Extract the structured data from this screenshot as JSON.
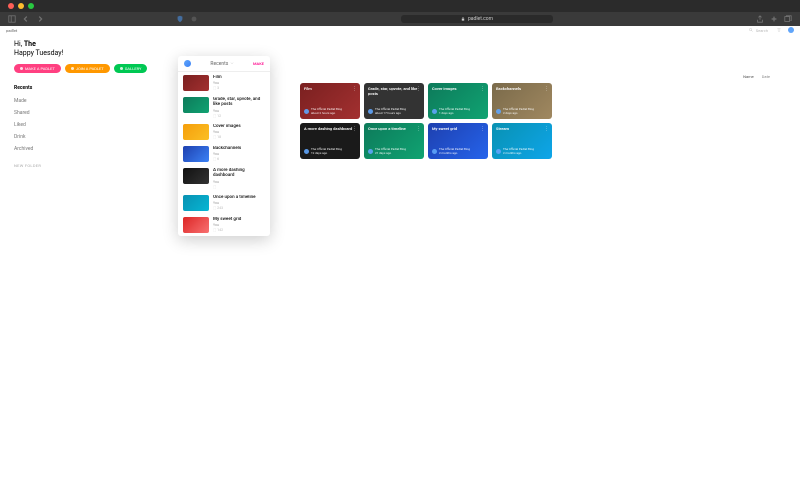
{
  "browser": {
    "url": "padlet.com",
    "brand": "padlet"
  },
  "search": {
    "placeholder": "Search"
  },
  "greeting": {
    "prefix": "Hi, ",
    "name": "The",
    "line2": "Happy Tuesday!"
  },
  "buttons": {
    "make": "MAKE A PADLET",
    "join": "JOIN A PADLET",
    "gallery": "GALLERY"
  },
  "nav": {
    "header": "Recents",
    "items": [
      "Made",
      "Shared",
      "Liked",
      "Drink",
      "Archived"
    ],
    "newfolder": "NEW FOLDER"
  },
  "dropdown": {
    "title": "Recents",
    "make": "MAKE",
    "items": [
      {
        "title": "Film",
        "author": "You",
        "count": "3",
        "thumb": "linear-gradient(135deg,#7a2020,#a33030)"
      },
      {
        "title": "Grade, star, upvote, and like posts",
        "author": "You",
        "count": "12",
        "thumb": "linear-gradient(135deg,#0d7a5a,#10a372)"
      },
      {
        "title": "Cover images",
        "author": "You",
        "count": "18",
        "thumb": "linear-gradient(135deg,#f59e0b,#fbbf24)"
      },
      {
        "title": "Backchannels",
        "author": "You",
        "count": "6",
        "thumb": "linear-gradient(135deg,#1e40af,#3b82f6)"
      },
      {
        "title": "A more dashing dashboard",
        "author": "You",
        "count": "",
        "thumb": "linear-gradient(135deg,#111,#333)"
      },
      {
        "title": "Once upon a timeline",
        "author": "You",
        "count": "243",
        "thumb": "linear-gradient(135deg,#0891b2,#06b6d4)"
      },
      {
        "title": "My sweet grid",
        "author": "You",
        "count": "142",
        "thumb": "linear-gradient(135deg,#dc2626,#f87171)"
      }
    ]
  },
  "gridhead": {
    "name": "Name",
    "date": "Date"
  },
  "cards": [
    {
      "title": "Film",
      "author": "The Official Padlet Blog",
      "time": "about 2 hours ago",
      "bg": "linear-gradient(135deg,#7a2020,#a33030)"
    },
    {
      "title": "Grade, star, upvote, and like posts",
      "author": "The Official Padlet Blog",
      "time": "about 17 hours ago",
      "bg": "#333"
    },
    {
      "title": "Cover images",
      "author": "The Official Padlet Blog",
      "time": "1 days ago",
      "bg": "linear-gradient(135deg,#0d7a5a,#10a372)"
    },
    {
      "title": "Backchannels",
      "author": "The Official Padlet Blog",
      "time": "2 days ago",
      "bg": "linear-gradient(135deg,#7a6a4a,#a08860)"
    },
    {
      "title": "A more dashing dashboard",
      "author": "The Official Padlet Blog",
      "time": "12 days ago",
      "bg": "#1a1a1a"
    },
    {
      "title": "Once upon a timeline",
      "author": "The Official Padlet Blog",
      "time": "21 days ago",
      "bg": "linear-gradient(135deg,#0d7a5a,#10a372)"
    },
    {
      "title": "My sweet grid",
      "author": "The Official Padlet Blog",
      "time": "2 months ago",
      "bg": "linear-gradient(135deg,#1e40af,#2563eb)"
    },
    {
      "title": "Stream",
      "author": "The Official Padlet Blog",
      "time": "2 months ago",
      "bg": "linear-gradient(135deg,#0891b2,#0ea5e9)"
    }
  ]
}
